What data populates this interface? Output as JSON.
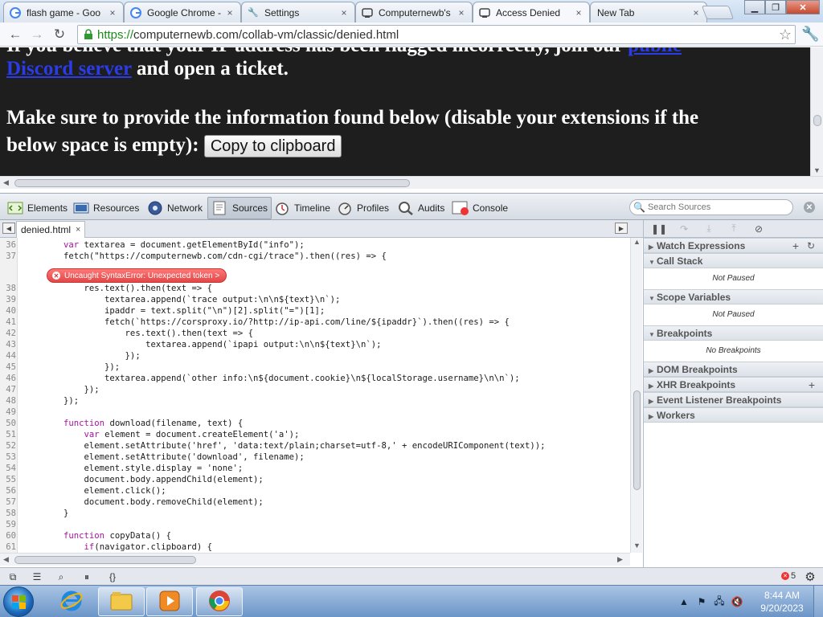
{
  "tabs": [
    {
      "title": "flash game - Goo",
      "icon": "google-icon",
      "active": false
    },
    {
      "title": "Google Chrome - ",
      "icon": "google-icon",
      "active": false
    },
    {
      "title": "Settings",
      "icon": "wrench-icon",
      "active": false
    },
    {
      "title": "Computernewb's",
      "icon": "site-icon",
      "active": false
    },
    {
      "title": "Access Denied",
      "icon": "site-icon",
      "active": true
    },
    {
      "title": "New Tab",
      "icon": "",
      "active": false
    }
  ],
  "toolbar": {
    "url_scheme": "https://",
    "url_rest": "computernewb.com/collab-vm/classic/denied.html"
  },
  "page": {
    "top_clip_text": "If you believe that your IP address has been flagged incorrectly, join our",
    "top_clip_link": "public",
    "link_text": "Discord server",
    "line1_rest": "and open a ticket.",
    "line2": "Make sure to provide the information found below (disable your extensions if the",
    "line3": "below space is empty):",
    "copy_button": "Copy to clipboard"
  },
  "devtools": {
    "tabs": [
      "Elements",
      "Resources",
      "Network",
      "Sources",
      "Timeline",
      "Profiles",
      "Audits",
      "Console"
    ],
    "active_tab": "Sources",
    "search_placeholder": "Search Sources",
    "file_tab": "denied.html",
    "error_message": "Uncaught SyntaxError: Unexpected token >",
    "error_count": "5",
    "sidebar": {
      "watch": "Watch Expressions",
      "call_stack": "Call Stack",
      "call_stack_status": "Not Paused",
      "scope": "Scope Variables",
      "scope_status": "Not Paused",
      "breakpoints": "Breakpoints",
      "breakpoints_status": "No Breakpoints",
      "dom_breakpoints": "DOM Breakpoints",
      "xhr_breakpoints": "XHR Breakpoints",
      "event_breakpoints": "Event Listener Breakpoints",
      "workers": "Workers"
    }
  },
  "code_lines": [
    {
      "n": "36",
      "t": "        var textarea = document.getElementById(\"info\");"
    },
    {
      "n": "37",
      "t": "        fetch(\"https://computernewb.com/cdn-cgi/trace\").then((res) => {"
    },
    {
      "n": "38",
      "t": "            res.text().then(text => {"
    },
    {
      "n": "39",
      "t": "                textarea.append(`trace output:\\n\\n${text}\\n`);"
    },
    {
      "n": "40",
      "t": "                ipaddr = text.split(\"\\n\")[2].split(\"=\")[1];"
    },
    {
      "n": "41",
      "t": "                fetch(`https://corsproxy.io/?http://ip-api.com/line/${ipaddr}`).then((res) => {"
    },
    {
      "n": "42",
      "t": "                    res.text().then(text => {"
    },
    {
      "n": "43",
      "t": "                        textarea.append(`ipapi output:\\n\\n${text}\\n`);"
    },
    {
      "n": "44",
      "t": "                    });"
    },
    {
      "n": "45",
      "t": "                });"
    },
    {
      "n": "46",
      "t": "                textarea.append(`other info:\\n${document.cookie}\\n${localStorage.username}\\n\\n`);"
    },
    {
      "n": "47",
      "t": "            });"
    },
    {
      "n": "48",
      "t": "        });"
    },
    {
      "n": "49",
      "t": ""
    },
    {
      "n": "50",
      "t": "        function download(filename, text) {"
    },
    {
      "n": "51",
      "t": "            var element = document.createElement('a');"
    },
    {
      "n": "52",
      "t": "            element.setAttribute('href', 'data:text/plain;charset=utf-8,' + encodeURIComponent(text));"
    },
    {
      "n": "53",
      "t": "            element.setAttribute('download', filename);"
    },
    {
      "n": "54",
      "t": "            element.style.display = 'none';"
    },
    {
      "n": "55",
      "t": "            document.body.appendChild(element);"
    },
    {
      "n": "56",
      "t": "            element.click();"
    },
    {
      "n": "57",
      "t": "            document.body.removeChild(element);"
    },
    {
      "n": "58",
      "t": "        }"
    },
    {
      "n": "59",
      "t": ""
    },
    {
      "n": "60",
      "t": "        function copyData() {"
    },
    {
      "n": "61",
      "t": "            if(navigator.clipboard) {"
    },
    {
      "n": "62",
      "t": ""
    }
  ],
  "taskbar": {
    "time": "8:44 AM",
    "date": "9/20/2023"
  },
  "colors": {
    "accent": "#1a66b8",
    "error": "#e04848",
    "page_bg": "#1e1e1e",
    "link": "#2a3be8"
  }
}
